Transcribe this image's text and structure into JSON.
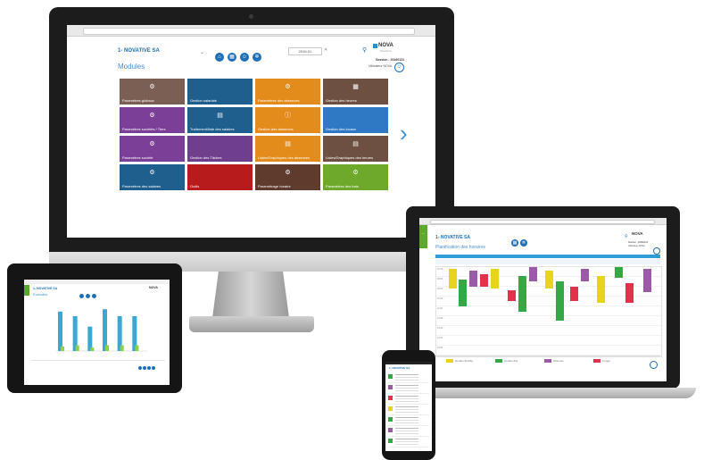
{
  "monitor": {
    "company": "1- NOVATIVE SA",
    "section_title": "Modules",
    "date": "2016-01",
    "session": "Session : 20160121",
    "user": "Utilisateur NOVA",
    "logo_text": "NOVA",
    "logo_sub": "Solutions",
    "next_arrow": "›",
    "tiles": [
      {
        "label": "Paramètres globaux",
        "color": "#7b5f55",
        "icon": "gear-icon",
        "glyph": "⚙"
      },
      {
        "label": "Gestion salariale",
        "color": "#1f5f8e",
        "icon": "",
        "glyph": ""
      },
      {
        "label": "Paramètres des absences",
        "color": "#e38b1b",
        "icon": "gear-icon",
        "glyph": "⚙"
      },
      {
        "label": "Gestion des heures",
        "color": "#6e5042",
        "icon": "calendar-icon",
        "glyph": "▦"
      },
      {
        "label": "Paramètres sociétés / Tiers",
        "color": "#7c3f98",
        "icon": "gear-icon",
        "glyph": "⚙"
      },
      {
        "label": "Traitement/liste des salaires",
        "color": "#1f5f8e",
        "icon": "document-icon",
        "glyph": "▤"
      },
      {
        "label": "Gestion des absences",
        "color": "#e38b1b",
        "icon": "info-icon",
        "glyph": "ⓘ"
      },
      {
        "label": "Gestion des locaux",
        "color": "#2f78c4",
        "icon": "",
        "glyph": ""
      },
      {
        "label": "Paramètres société",
        "color": "#7c3f98",
        "icon": "gear-icon",
        "glyph": "⚙"
      },
      {
        "label": "Gestion des Tâches",
        "color": "#6f3f8e",
        "icon": "",
        "glyph": ""
      },
      {
        "label": "Listes/Graphiques des absences",
        "color": "#e38b1b",
        "icon": "document-icon",
        "glyph": "▤"
      },
      {
        "label": "Listes/Graphiques des heures",
        "color": "#6e5042",
        "icon": "document-icon",
        "glyph": "▤"
      },
      {
        "label": "Paramètres des salaires",
        "color": "#1f5f8e",
        "icon": "gear-icon",
        "glyph": "⚙"
      },
      {
        "label": "Outils",
        "color": "#b81b1b",
        "icon": "",
        "glyph": ""
      },
      {
        "label": "Paramétrage horaire",
        "color": "#5e3b2c",
        "icon": "gear-icon",
        "glyph": "⚙"
      },
      {
        "label": "Paramètres des frais",
        "color": "#6ea92b",
        "icon": "gear-icon",
        "glyph": "⚙"
      }
    ]
  },
  "laptop": {
    "company": "1- NOVATIVE SA",
    "section_title": "Planification des horaires",
    "session": "Session : 20160121",
    "user": "Utilisateur NOVA",
    "logo_text": "NOVA",
    "time_labels": [
      "07:00",
      "08:00",
      "09:00",
      "10:00",
      "11:00",
      "12:00",
      "13:00",
      "14:00",
      "15:00"
    ],
    "legend": [
      {
        "label": "Horaire flexible",
        "color": "#e8d41e"
      },
      {
        "label": "Horaire fixe",
        "color": "#34a844"
      },
      {
        "label": "Absence",
        "color": "#9b5aa8"
      },
      {
        "label": "Congé",
        "color": "#e0334b"
      }
    ],
    "events": [
      {
        "color": "#e8d41e"
      },
      {
        "color": "#34a844"
      },
      {
        "color": "#9b5aa8"
      },
      {
        "color": "#e0334b"
      },
      {
        "color": "#e8d41e"
      },
      {
        "color": "#e0334b"
      },
      {
        "color": "#34a844"
      },
      {
        "color": "#9b5aa8"
      },
      {
        "color": "#e8d41e"
      },
      {
        "color": "#34a844"
      },
      {
        "color": "#e0334b"
      },
      {
        "color": "#9b5aa8"
      },
      {
        "color": "#e8d41e"
      },
      {
        "color": "#34a844"
      },
      {
        "color": "#e0334b"
      },
      {
        "color": "#9b5aa8"
      }
    ]
  },
  "tablet": {
    "company": "1- NOVATIVE SA",
    "section_title": "Evaluation",
    "logo_text": "NOVA",
    "chart_data": {
      "type": "bar",
      "series": [
        {
          "name": "",
          "values": [
            34,
            30,
            21,
            36,
            30,
            30
          ],
          "color": "#39a8d6"
        },
        {
          "name": "",
          "values": [
            4,
            5,
            3,
            5,
            5,
            5
          ],
          "color": "#8bd14b"
        }
      ],
      "ylim": [
        0,
        40
      ]
    }
  },
  "phone": {
    "company": "1- NOVATIVE SA",
    "items": [
      {
        "color": "#34a844"
      },
      {
        "color": "#9b5aa8"
      },
      {
        "color": "#e0334b"
      },
      {
        "color": "#e8d41e"
      },
      {
        "color": "#34a844"
      },
      {
        "color": "#9b5aa8"
      },
      {
        "color": "#34a844"
      }
    ]
  }
}
